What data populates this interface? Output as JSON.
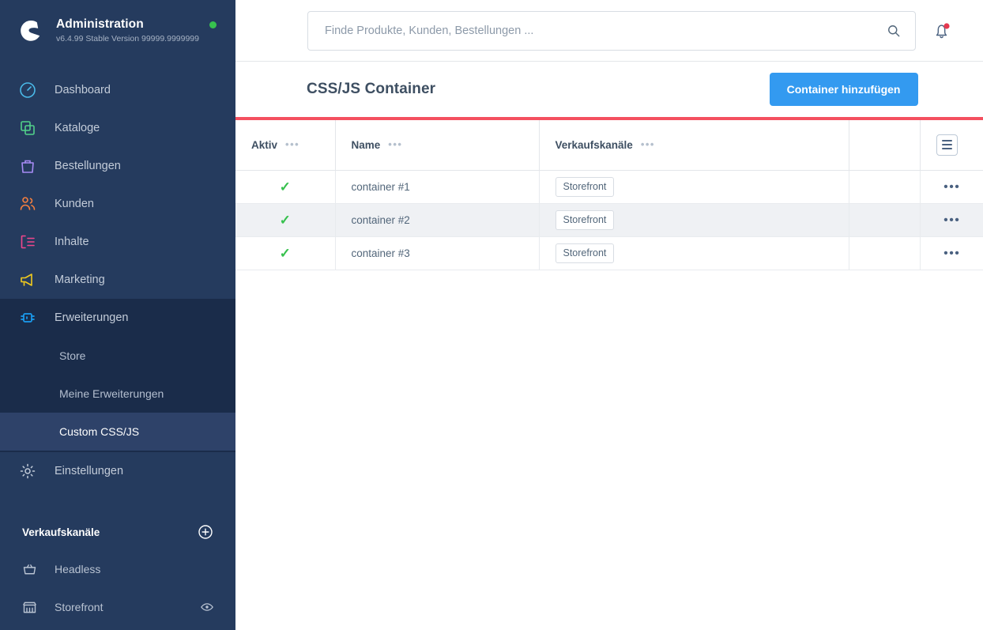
{
  "sidebar": {
    "brand": {
      "title": "Administration",
      "version": "v6.4.99 Stable Version 99999.9999999",
      "logo_icon": "shopware-logo-icon",
      "status_dot_color": "#37c14e"
    },
    "nav": [
      {
        "label": "Dashboard",
        "icon": "gauge-icon",
        "color": "#4ab9e8"
      },
      {
        "label": "Kataloge",
        "icon": "copy-icon",
        "color": "#52d18a"
      },
      {
        "label": "Bestellungen",
        "icon": "bag-icon",
        "color": "#a78bf5"
      },
      {
        "label": "Kunden",
        "icon": "users-icon",
        "color": "#f57f3f"
      },
      {
        "label": "Inhalte",
        "icon": "content-icon",
        "color": "#f0468c"
      },
      {
        "label": "Marketing",
        "icon": "megaphone-icon",
        "color": "#f2cb1d"
      },
      {
        "label": "Erweiterungen",
        "icon": "plugin-icon",
        "color": "#1a9cf0"
      }
    ],
    "submenu": [
      {
        "label": "Store",
        "active": false
      },
      {
        "label": "Meine Erweiterungen",
        "active": false
      },
      {
        "label": "Custom CSS/JS",
        "active": true
      }
    ],
    "settings": {
      "label": "Einstellungen",
      "icon": "gear-icon"
    },
    "sales_channels": {
      "title": "Verkaufskanäle",
      "add_icon": "plus-circle-icon",
      "items": [
        {
          "label": "Headless",
          "icon": "basket-icon",
          "trailing_icon": ""
        },
        {
          "label": "Storefront",
          "icon": "shop-icon",
          "trailing_icon": "eye-icon"
        }
      ]
    },
    "colors": {
      "background": "#253b5e",
      "submenu_background": "#1a2c4a",
      "active_background": "#2e4269"
    }
  },
  "topbar": {
    "search": {
      "placeholder": "Finde Produkte, Kunden, Bestellungen ...",
      "value": "",
      "icon": "search-icon"
    },
    "notifications": {
      "icon": "bell-icon",
      "has_unread": true,
      "dot_color": "#e5384f"
    }
  },
  "page": {
    "title": "CSS/JS Container",
    "primary_action": {
      "label": "Container hinzufügen",
      "color": "#339af0"
    },
    "progress_bar_color": "#f4505f"
  },
  "table": {
    "columns": [
      {
        "key": "active",
        "label": "Aktiv",
        "has_menu": true
      },
      {
        "key": "name",
        "label": "Name",
        "has_menu": true
      },
      {
        "key": "sc",
        "label": "Verkaufskanäle",
        "has_menu": true
      },
      {
        "key": "blank",
        "label": "",
        "has_menu": false
      },
      {
        "key": "act",
        "label": "",
        "has_menu": false
      }
    ],
    "settings_button_icon": "list-settings-icon",
    "row_action_icon": "ellipsis-icon",
    "active_icon": "check-icon",
    "active_icon_color": "#37c14e",
    "rows": [
      {
        "active": "✓",
        "name": "container #1",
        "channels": [
          "Storefront"
        ],
        "highlighted": false,
        "actions": "•••"
      },
      {
        "active": "✓",
        "name": "container #2",
        "channels": [
          "Storefront"
        ],
        "highlighted": true,
        "actions": "•••"
      },
      {
        "active": "✓",
        "name": "container #3",
        "channels": [
          "Storefront"
        ],
        "highlighted": false,
        "actions": "•••"
      }
    ]
  }
}
